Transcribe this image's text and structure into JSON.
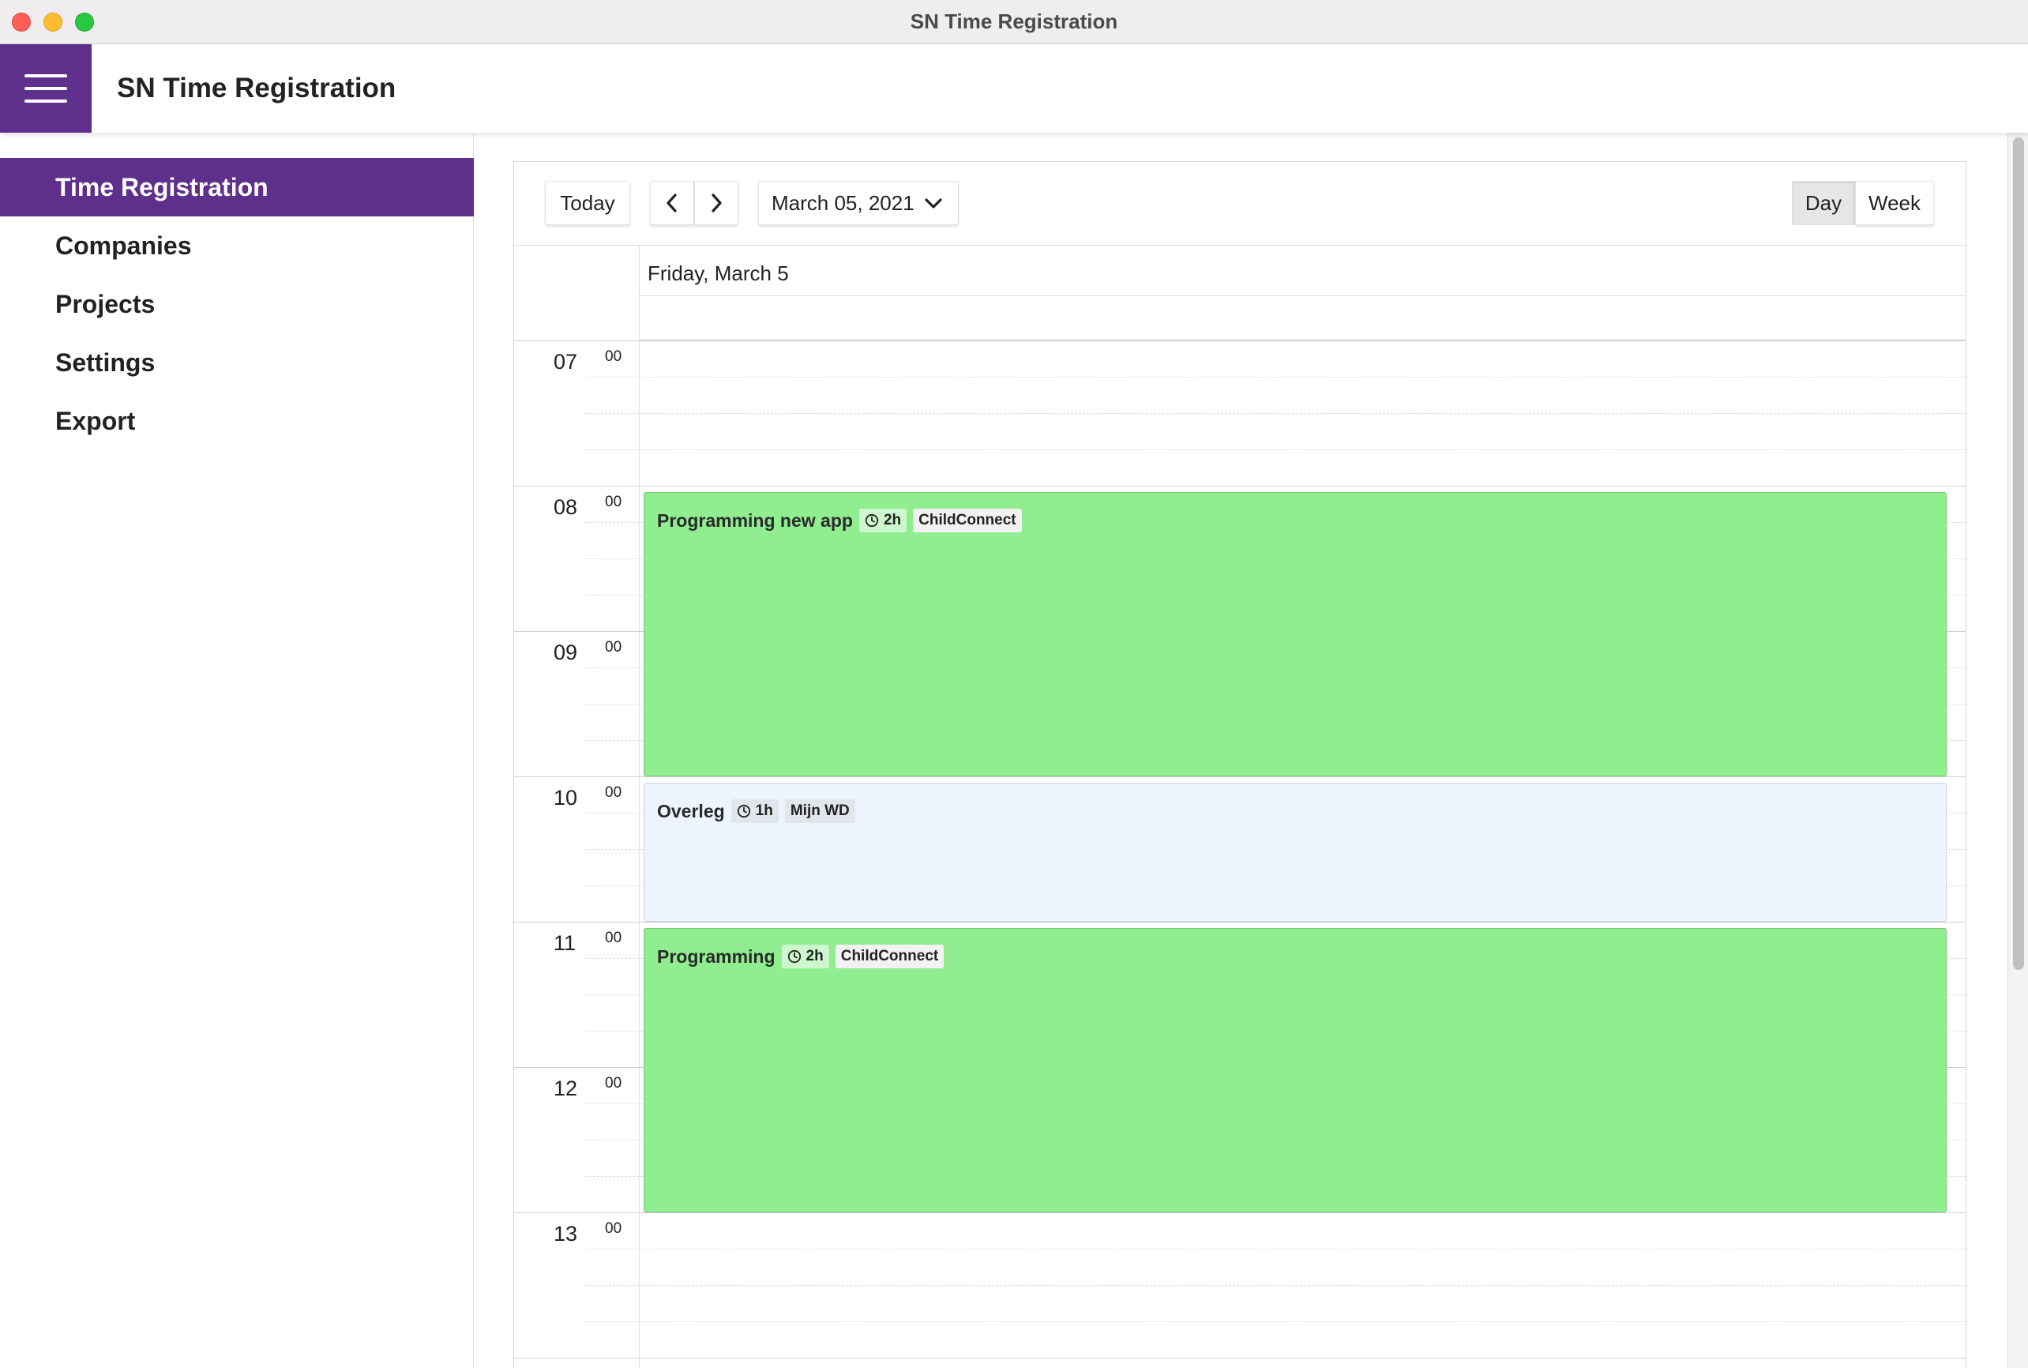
{
  "window": {
    "title": "SN Time Registration"
  },
  "appbar": {
    "title": "SN Time Registration"
  },
  "sidebar": {
    "items": [
      {
        "label": "Time Registration",
        "active": true
      },
      {
        "label": "Companies",
        "active": false
      },
      {
        "label": "Projects",
        "active": false
      },
      {
        "label": "Settings",
        "active": false
      },
      {
        "label": "Export",
        "active": false
      }
    ]
  },
  "toolbar": {
    "today_label": "Today",
    "date_label": "March 05, 2021",
    "day_label": "Day",
    "week_label": "Week",
    "active_view": "Day"
  },
  "calendar": {
    "day_header": "Friday, March 5",
    "hours": [
      "07",
      "08",
      "09",
      "10",
      "11",
      "12",
      "13"
    ],
    "minute_label": "00",
    "events": [
      {
        "title": "Programming new app",
        "duration": "2h",
        "project": "ChildConnect",
        "color": "#90ee90"
      },
      {
        "title": "Overleg",
        "duration": "1h",
        "project": "Mijn WD",
        "color": "#edf4fd"
      },
      {
        "title": "Programming",
        "duration": "2h",
        "project": "ChildConnect",
        "color": "#90ee90"
      }
    ]
  },
  "colors": {
    "accent": "#5f2f8c",
    "event_green": "#90ee90",
    "event_blue": "#edf4fd"
  }
}
